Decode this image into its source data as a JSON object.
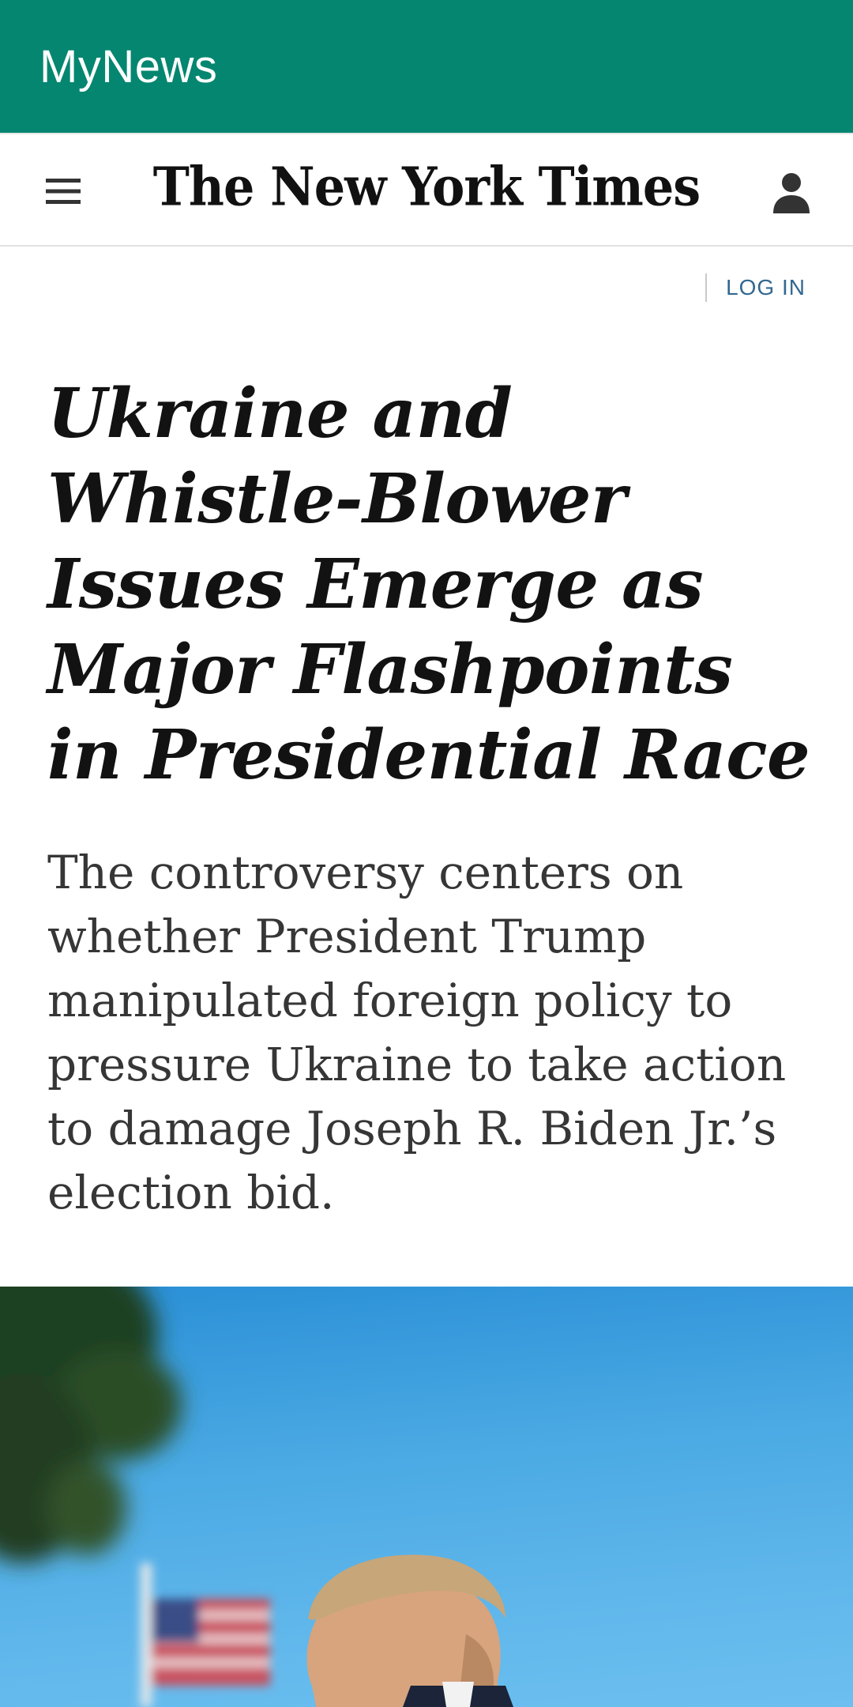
{
  "app_bar": {
    "title": "MyNews",
    "color": "#058670"
  },
  "site_header": {
    "logo_text": "The New York Times",
    "menu_icon": "hamburger-menu-icon",
    "account_icon": "person-icon"
  },
  "login": {
    "label": "LOG IN",
    "color": "#326891"
  },
  "article": {
    "headline": "Ukraine and Whistle-Blower Issues Emerge as Major Flashpoints in Presidential Race",
    "summary": "The controversy centers on whether President Trump manipulated foreign policy to pressure Ukraine to take action to damage Joseph R. Biden Jr.’s election bid."
  }
}
